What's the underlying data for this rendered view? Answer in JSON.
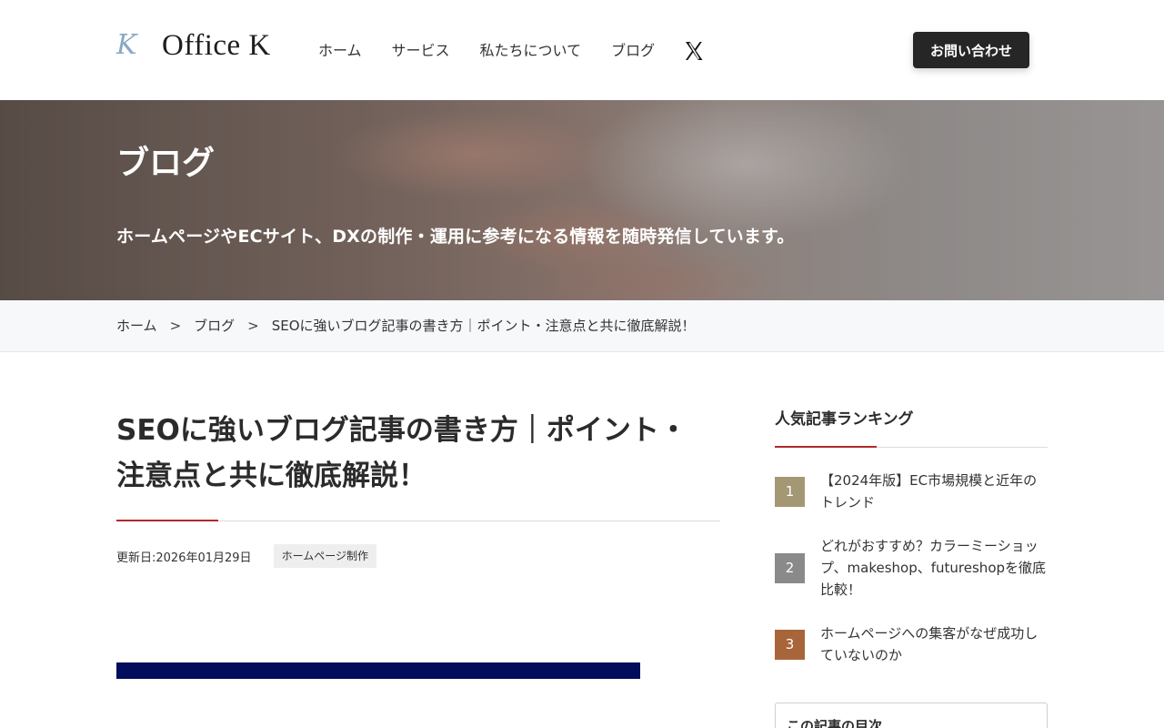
{
  "header": {
    "logo_mark": "K",
    "logo_text": "Office K",
    "nav": [
      "ホーム",
      "サービス",
      "私たちについて",
      "ブログ"
    ],
    "contact_label": "お問い合わせ"
  },
  "hero": {
    "title": "ブログ",
    "subtitle": "ホームページやECサイト、DXの制作・運用に参考になる情報を随時発信しています。"
  },
  "breadcrumb": {
    "home": "ホーム",
    "blog": "ブログ",
    "separator": ">",
    "current": "SEOに強いブログ記事の書き方｜ポイント・注意点と共に徹底解説！"
  },
  "article": {
    "title_line1": "SEOに強いブログ記事の書き方｜ポイント・",
    "title_line2": "注意点と共に徹底解説！",
    "updated": "更新日:2026年01月29日",
    "tag": "ホームページ制作"
  },
  "sidebar": {
    "ranking_title": "人気記事ランキング",
    "ranking": [
      {
        "rank": "1",
        "title": "【2024年版】EC市場規模と近年のトレンド",
        "color": "#a39873"
      },
      {
        "rank": "2",
        "title": "どれがおすすめ？カラーミーショップ、makeshop、futureshopを徹底比較！",
        "color": "#8a8a8a"
      },
      {
        "rank": "3",
        "title": "ホームページへの集客がなぜ成功していないのか",
        "color": "#a8653a"
      }
    ],
    "toc_title": "この記事の目次"
  },
  "colors": {
    "accent": "#b02a2a",
    "button": "#262626",
    "banner": "#020d5b"
  }
}
